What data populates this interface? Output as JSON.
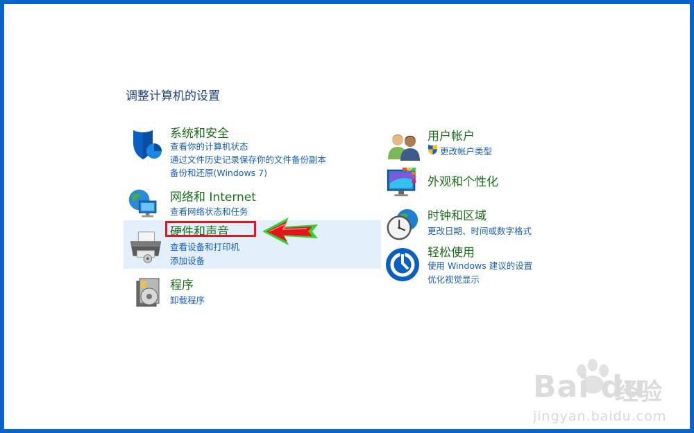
{
  "page": {
    "title": "调整计算机的设置"
  },
  "left_categories": [
    {
      "title": "系统和安全",
      "icon": "shield-icon",
      "links": [
        "查看你的计算机状态",
        "通过文件历史记录保存你的文件备份副本",
        "备份和还原(Windows 7)"
      ]
    },
    {
      "title": "网络和 Internet",
      "icon": "network-globe-icon",
      "links": [
        "查看网络状态和任务"
      ]
    },
    {
      "title": "硬件和声音",
      "icon": "printer-icon",
      "links": [
        "查看设备和打印机",
        "添加设备"
      ]
    },
    {
      "title": "程序",
      "icon": "programs-disc-icon",
      "links": [
        "卸载程序"
      ]
    }
  ],
  "right_categories": [
    {
      "title": "用户帐户",
      "icon": "users-icon",
      "links": [
        "更改帐户类型"
      ],
      "link_icon": "uac-shield-icon"
    },
    {
      "title": "外观和个性化",
      "icon": "monitor-palette-icon",
      "links": []
    },
    {
      "title": "时钟和区域",
      "icon": "clock-globe-icon",
      "links": [
        "更改日期、时间或数字格式"
      ]
    },
    {
      "title": "轻松使用",
      "icon": "ease-of-access-icon",
      "links": [
        "使用 Windows 建议的设置",
        "优化视觉显示"
      ]
    }
  ],
  "annotation": {
    "arrow_color": "#e8131b",
    "box_color": "#e8131b",
    "glow_color": "#2fd62f"
  },
  "watermark": {
    "logo": "Bai du",
    "cn": "经验",
    "url": "jingyan.baidu.com"
  },
  "colors": {
    "frame": "#0a64c8",
    "title_green": "#1b6e1b",
    "link_blue": "#1a5fb4",
    "highlight": "#e3effb"
  }
}
